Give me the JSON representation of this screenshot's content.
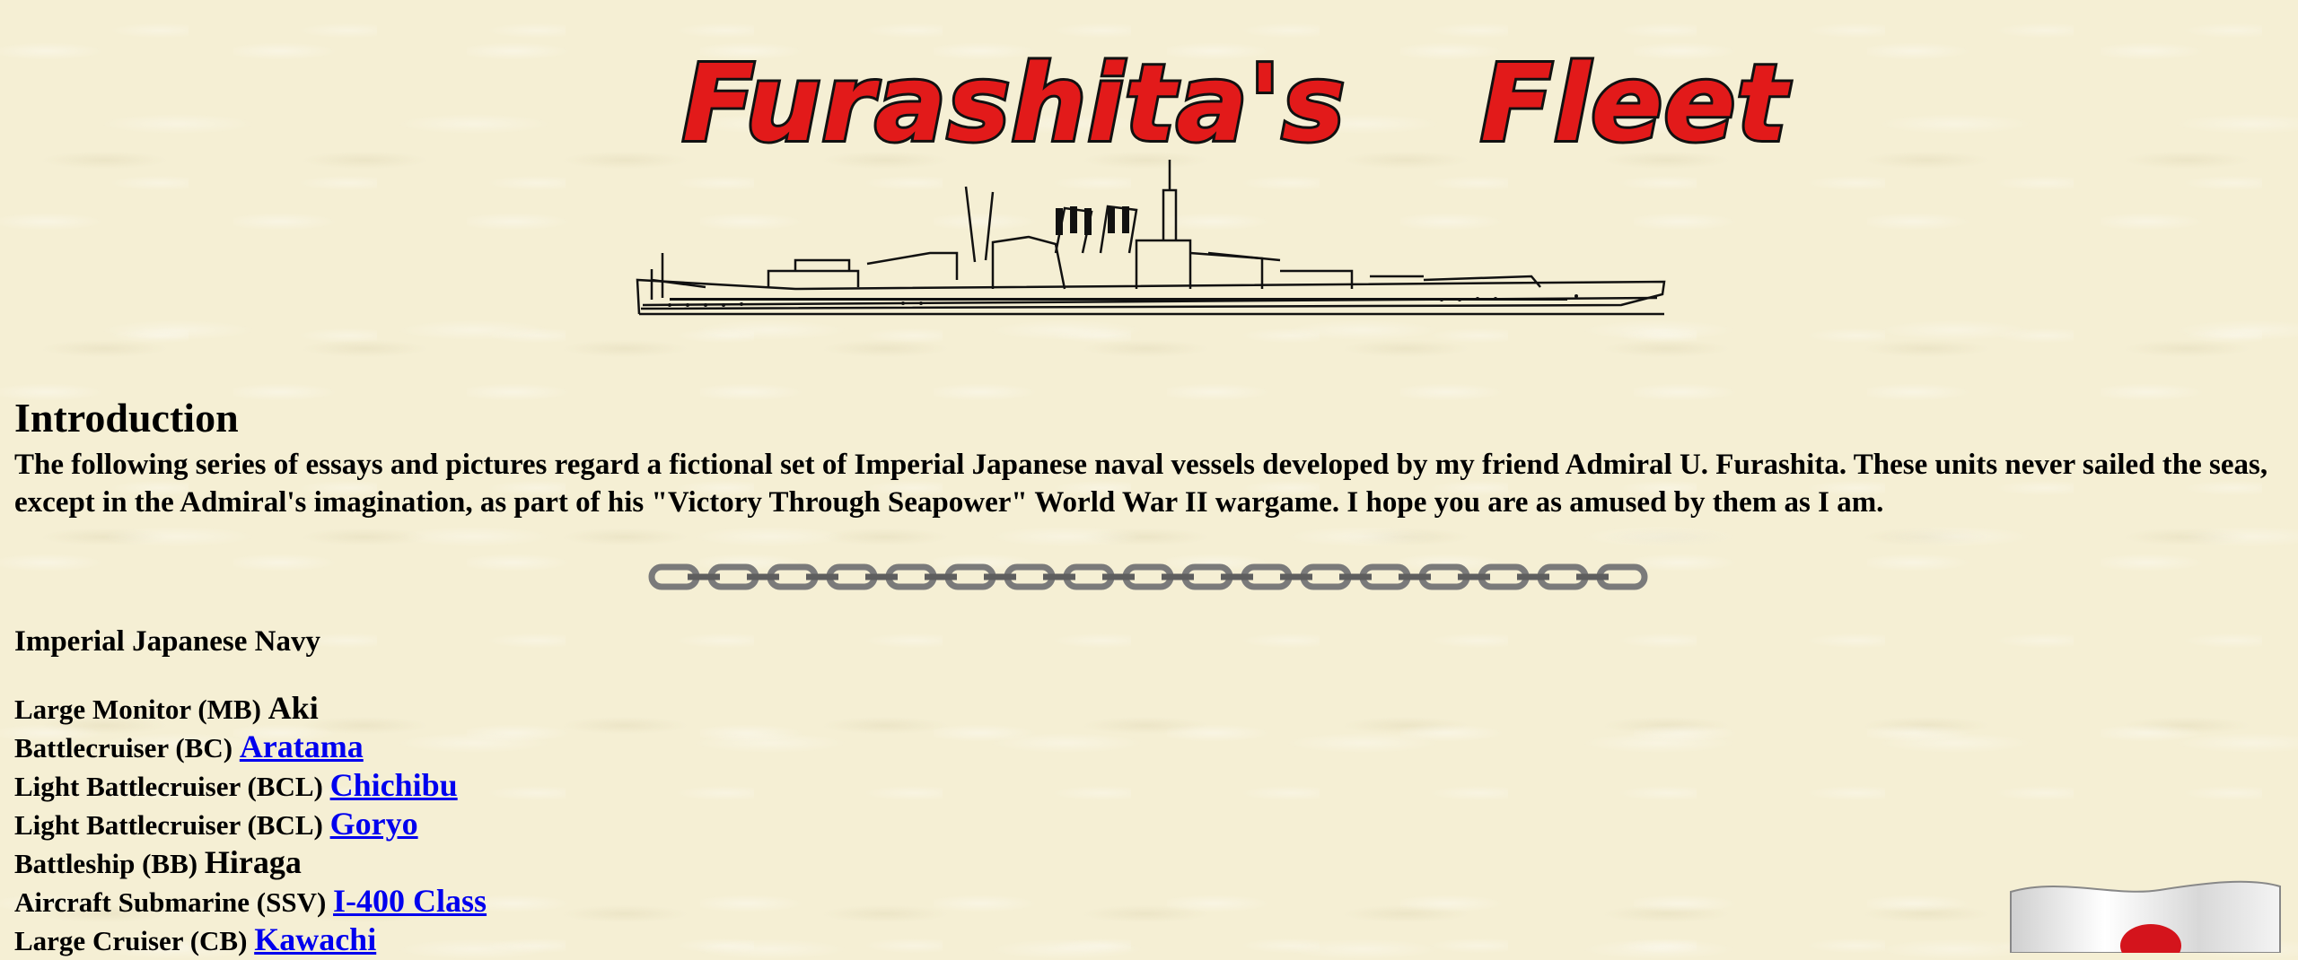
{
  "header": {
    "banner_word_1": "Furashita's",
    "banner_word_2": "Fleet",
    "banner_color": "#e21a1a",
    "ship_illustration": "battleship-line-drawing"
  },
  "intro": {
    "title": "Introduction",
    "text": "The following series of essays and pictures regard a fictional set of Imperial Japanese naval vessels developed by my friend Admiral U. Furashita. These units never sailed the seas, except in the Admiral's imagination, as part of his \"Victory Through Seapower\" World War II wargame. I hope you are as amused by them as I am."
  },
  "divider": "chain-divider",
  "navy": {
    "title": "Imperial Japanese Navy",
    "ships": [
      {
        "type": "Large Monitor (MB)",
        "name": "Aki",
        "link": false
      },
      {
        "type": "Battlecruiser (BC)",
        "name": "Aratama",
        "link": true
      },
      {
        "type": "Light Battlecruiser (BCL)",
        "name": "Chichibu",
        "link": true
      },
      {
        "type": "Light Battlecruiser (BCL)",
        "name": "Goryo",
        "link": true
      },
      {
        "type": "Battleship (BB)",
        "name": "Hiraga",
        "link": false
      },
      {
        "type": "Aircraft Submarine (SSV)",
        "name": "I-400 Class",
        "link": true
      },
      {
        "type": "Large Cruiser (CB)",
        "name": "Kawachi",
        "link": true
      }
    ]
  },
  "colors": {
    "background": "#f5efd4",
    "link": "#0000ee"
  },
  "flag_icon": "japanese-flag-icon"
}
